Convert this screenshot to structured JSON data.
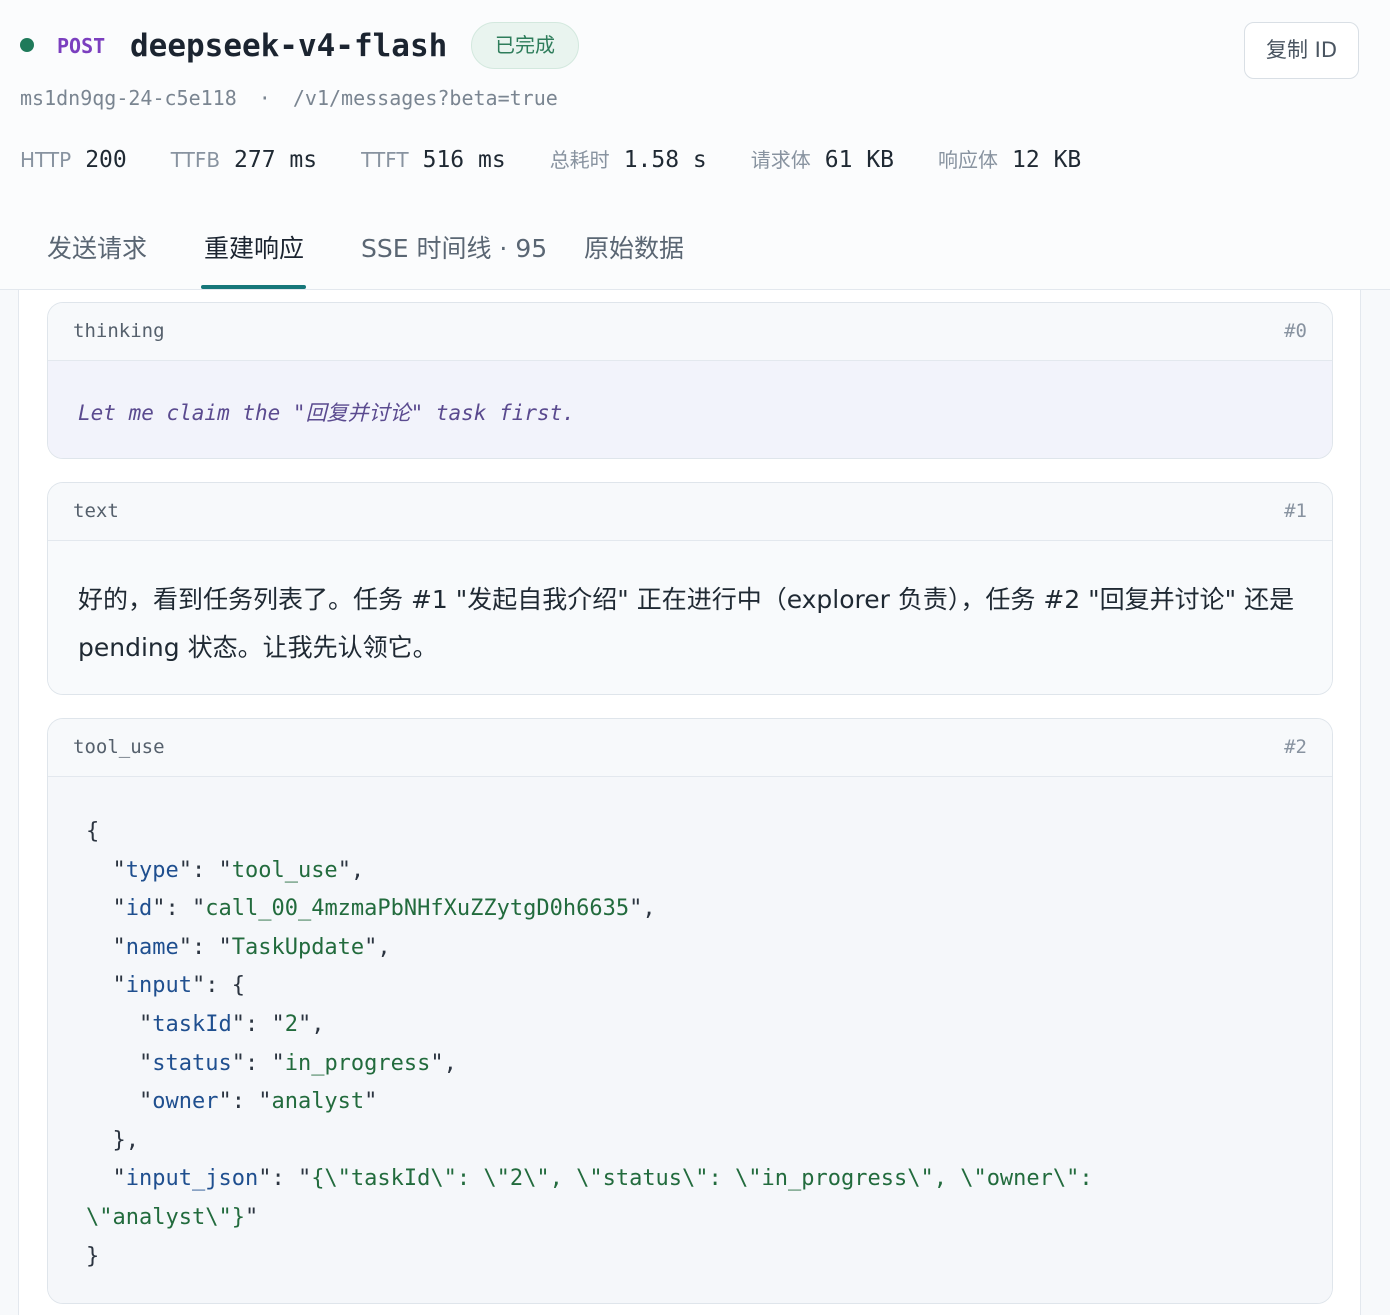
{
  "header": {
    "method": "POST",
    "model": "deepseek-v4-flash",
    "status_badge": "已完成",
    "copy_button": "复制 ID",
    "request_id": "ms1dn9qg-24-c5e118",
    "separator": "·",
    "path": "/v1/messages?beta=true",
    "status_color": "#1f7a5a"
  },
  "stats": [
    {
      "label": "HTTP",
      "value": "200"
    },
    {
      "label": "TTFB",
      "value": "277 ms"
    },
    {
      "label": "TTFT",
      "value": "516 ms"
    },
    {
      "label": "总耗时",
      "value": "1.58 s"
    },
    {
      "label": "请求体",
      "value": "61 KB"
    },
    {
      "label": "响应体",
      "value": "12 KB"
    }
  ],
  "tabs": [
    {
      "label": "发送请求"
    },
    {
      "label": "重建响应"
    },
    {
      "label": "SSE 时间线 · 95"
    },
    {
      "label": "原始数据"
    }
  ],
  "active_tab": "重建响应",
  "blocks": [
    {
      "type": "thinking",
      "index": "#0",
      "content": "Let me claim the \"回复并讨论\" task first."
    },
    {
      "type": "text",
      "index": "#1",
      "content": "好的，看到任务列表了。任务 #1 \"发起自我介绍\" 正在进行中（explorer 负责），任务 #2 \"回复并讨论\" 还是 pending 状态。让我先认领它。"
    },
    {
      "type": "tool_use",
      "index": "#2",
      "json": {
        "type": "tool_use",
        "id": "call_00_4mzmaPbNHfXuZZytgD0h6635",
        "name": "TaskUpdate",
        "input": {
          "taskId": "2",
          "status": "in_progress",
          "owner": "analyst"
        },
        "input_json": "{\\\"taskId\\\": \\\"2\\\", \\\"status\\\": \\\"in_progress\\\", \\\"owner\\\":",
        "input_json_cont": "\\\"analyst\\\"}"
      }
    }
  ]
}
